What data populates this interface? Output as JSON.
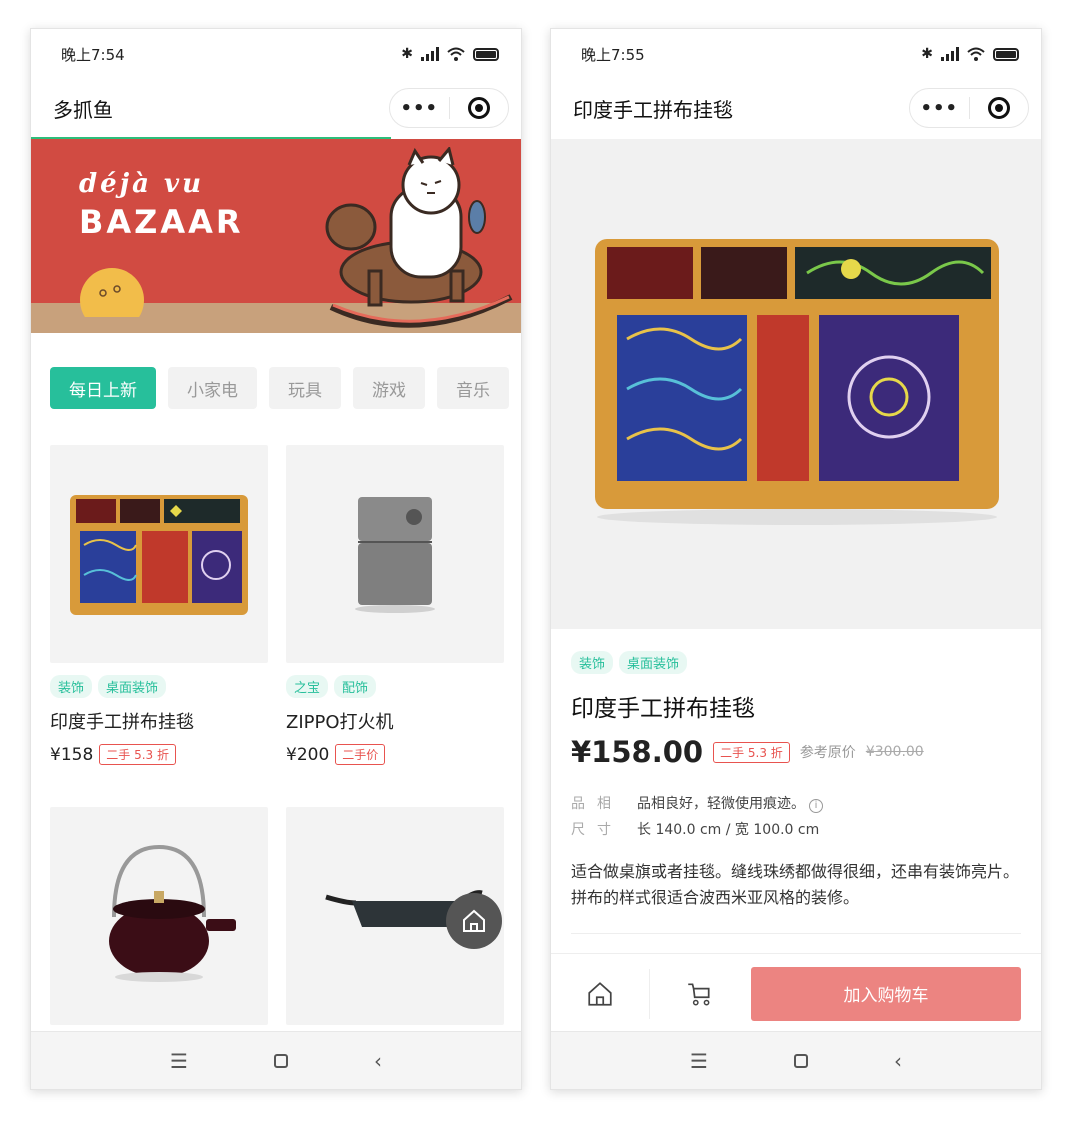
{
  "left": {
    "status": {
      "time": "晚上7:54"
    },
    "nav": {
      "title": "多抓鱼",
      "more": "•••"
    },
    "banner": {
      "line1": "déjà vu",
      "line2": "BAZAAR"
    },
    "tabs": [
      "每日上新",
      "小家电",
      "玩具",
      "游戏",
      "音乐"
    ],
    "products": [
      {
        "tags": [
          "装饰",
          "桌面装饰"
        ],
        "name": "印度手工拼布挂毯",
        "price": "¥158",
        "badge": "二手 5.3 折"
      },
      {
        "tags": [
          "之宝",
          "配饰"
        ],
        "name": "ZIPPO打火机",
        "price": "¥200",
        "badge": "二手价"
      }
    ],
    "sysnav": {
      "menu": "☰",
      "back": "‹"
    }
  },
  "right": {
    "status": {
      "time": "晚上7:55"
    },
    "nav": {
      "title": "印度手工拼布挂毯",
      "more": "•••"
    },
    "tags": [
      "装饰",
      "桌面装饰"
    ],
    "title": "印度手工拼布挂毯",
    "price": "¥158.00",
    "badge": "二手 5.3 折",
    "ref_label": "参考原价",
    "orig_price": "¥300.00",
    "specs": [
      {
        "label": "品相",
        "value": "品相良好，轻微使用痕迹。"
      },
      {
        "label": "尺寸",
        "value": "长 140.0 cm / 宽 100.0 cm"
      }
    ],
    "description": "适合做桌旗或者挂毯。缝线珠绣都做得很细，还串有装饰亮片。拼布的样式很适合波西米亚风格的装修。",
    "add_to_cart": "加入购物车",
    "sysnav": {
      "menu": "☰",
      "back": "‹"
    }
  }
}
